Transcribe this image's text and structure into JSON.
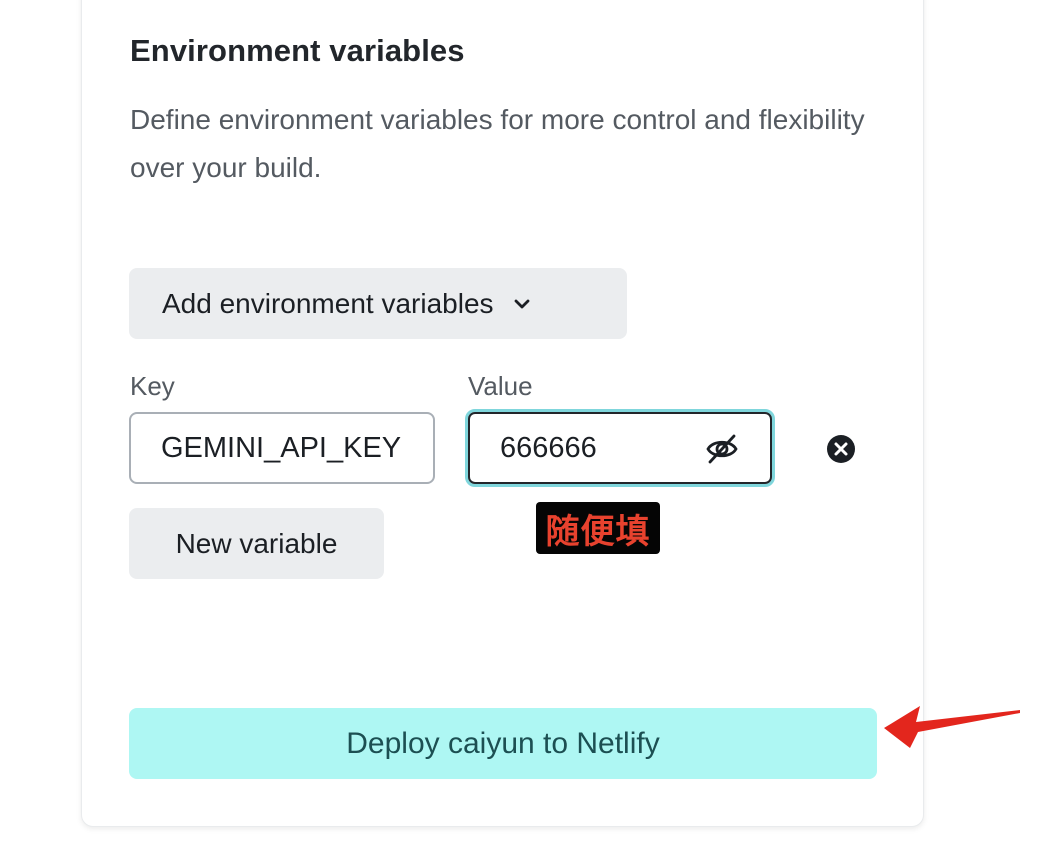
{
  "section": {
    "title": "Environment variables",
    "description": "Define environment variables for more control and flexibility over your build."
  },
  "add_button": {
    "label": "Add environment variables",
    "icon": "chevron-down-icon"
  },
  "variable": {
    "key_label": "Key",
    "value_label": "Value",
    "key_value": "GEMINI_API_KEY",
    "value_value": "666666",
    "visibility_icon": "eye-off-icon",
    "remove_icon": "close-circle-icon"
  },
  "new_variable_button": {
    "label": "New variable"
  },
  "annotation": {
    "text": "随便填",
    "color": "#e8422e"
  },
  "deploy_button": {
    "label": "Deploy caiyun to Netlify",
    "color": "#aef7f3"
  },
  "pointer": {
    "icon": "red-arrow-icon",
    "color": "#e3261d"
  }
}
